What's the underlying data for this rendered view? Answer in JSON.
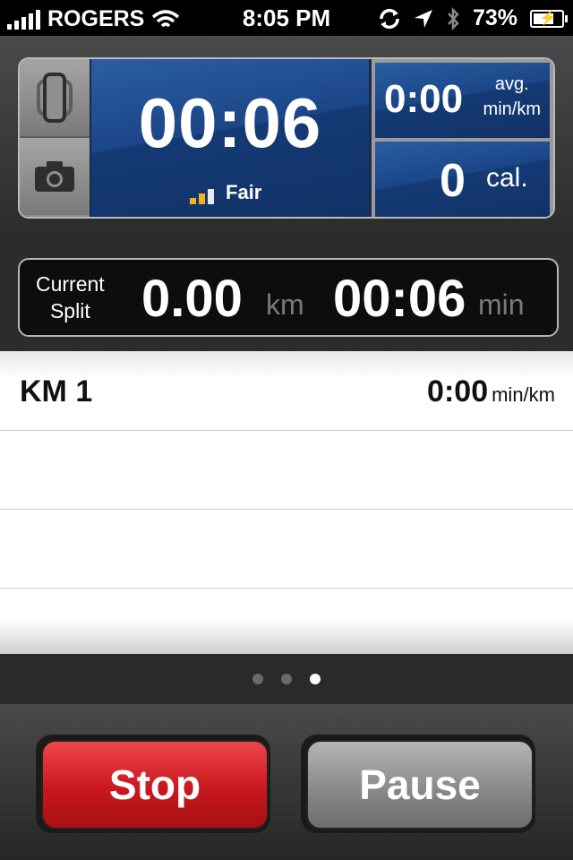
{
  "status_bar": {
    "carrier": "ROGERS",
    "time": "8:05 PM",
    "battery_percent": "73%"
  },
  "run": {
    "elapsed_time": "00:06",
    "gps_label": "Fair",
    "pace_value": "0:00",
    "pace_unit_line1": "avg.",
    "pace_unit_line2": "min/km",
    "calories_value": "0",
    "calories_unit": "cal."
  },
  "split": {
    "label_line1": "Current",
    "label_line2": "Split",
    "distance": "0.00",
    "distance_unit": "km",
    "time": "00:06",
    "time_unit": "min"
  },
  "splits_list": [
    {
      "label": "KM 1",
      "pace": "0:00",
      "unit": "min/km"
    }
  ],
  "pager": {
    "total": 3,
    "active_index": 2
  },
  "buttons": {
    "stop_label": "Stop",
    "pause_label": "Pause"
  },
  "colors": {
    "stop": "#c8181d",
    "pause": "#8a8a8a",
    "display_blue": "#1b4688",
    "gps_active": "#f3b41b"
  }
}
